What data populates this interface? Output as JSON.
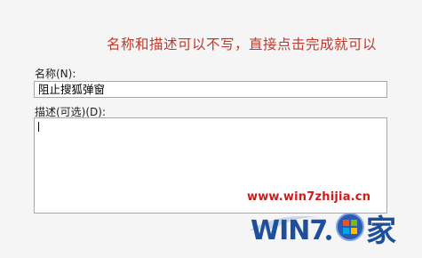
{
  "annotation": {
    "text": "名称和描述可以不写，直接点击完成就可以"
  },
  "form": {
    "name_label": "名称(N):",
    "name_value": "阻止搜狐弹窗",
    "description_label": "描述(可选)(D):",
    "description_value": ""
  },
  "watermark": {
    "url": "www.win7zhijia.cn",
    "logo_text": "WIN7.家",
    "colors": {
      "red": "#d11a1a",
      "blue": "#1e4f9a"
    }
  }
}
